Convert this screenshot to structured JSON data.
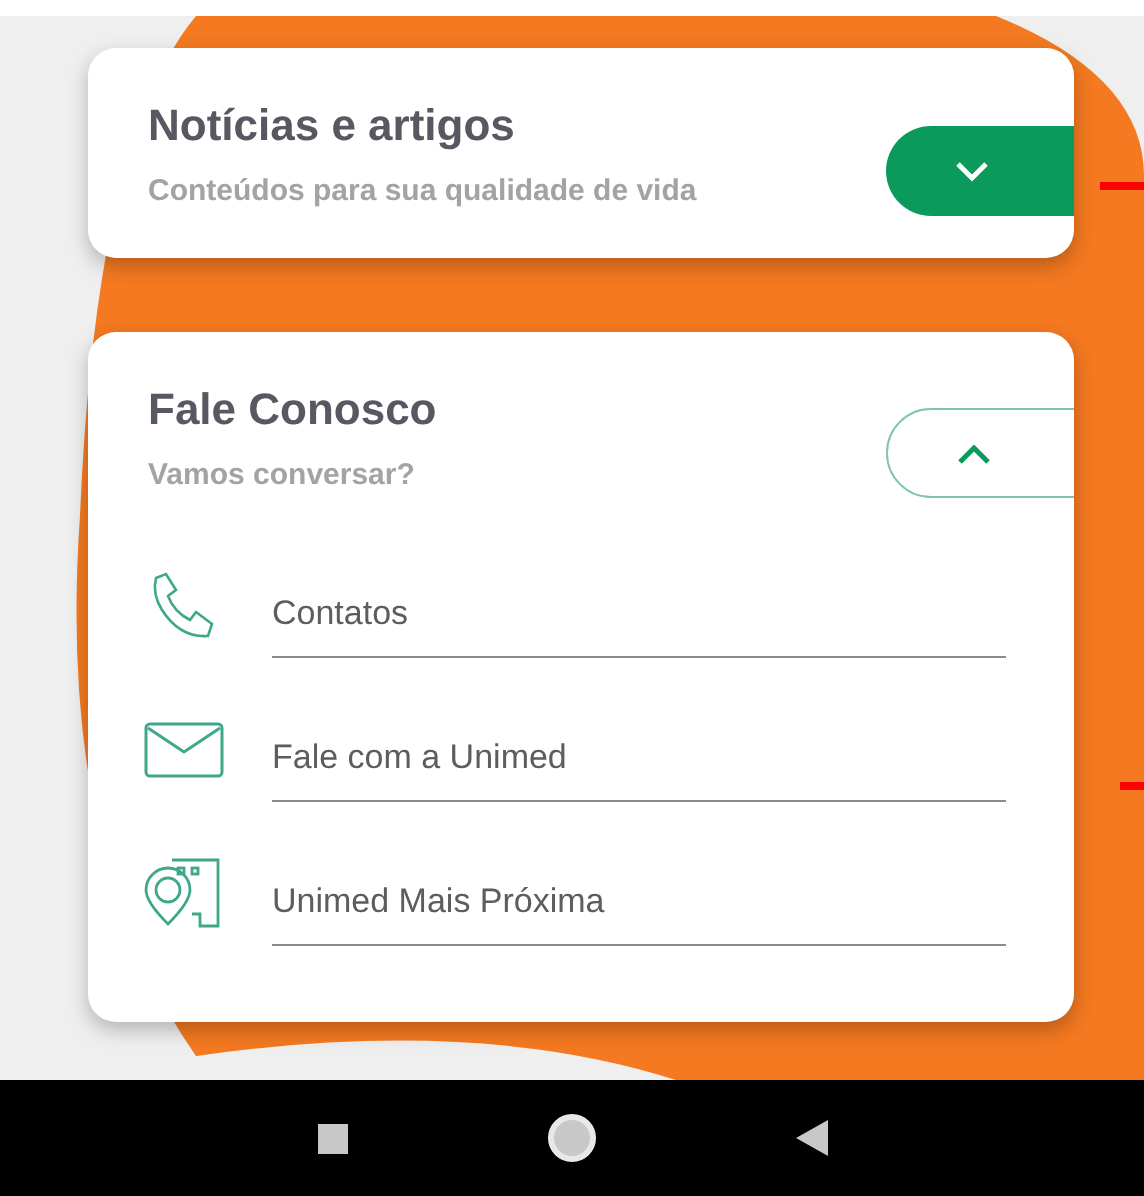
{
  "sections": [
    {
      "title": "Notícias e artigos",
      "subtitle": "Conteúdos para sua qualidade de vida",
      "expanded": false
    },
    {
      "title": "Fale Conosco",
      "subtitle": "Vamos conversar?",
      "expanded": true,
      "items": [
        {
          "kind": "phone",
          "label": "Contatos"
        },
        {
          "kind": "mail",
          "label": "Fale com a Unimed"
        },
        {
          "kind": "location",
          "label": "Unimed Mais Próxima"
        }
      ]
    }
  ]
}
